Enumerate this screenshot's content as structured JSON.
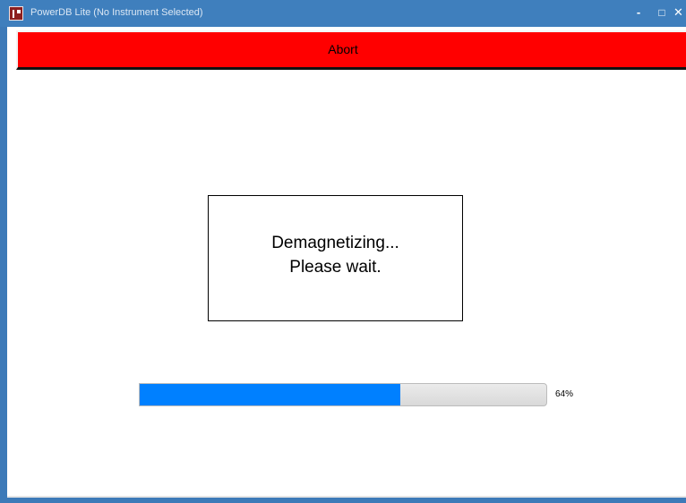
{
  "window": {
    "title": "PowerDB Lite (No Instrument Selected)",
    "minimize_glyph": "-",
    "maximize_glyph": "□",
    "close_glyph": "✕"
  },
  "toolbar": {
    "abort_label": "Abort",
    "abort_color": "#ff0000"
  },
  "status": {
    "line1": "Demagnetizing...",
    "line2": "Please wait."
  },
  "progress": {
    "value": 0.64,
    "label": "64%",
    "fill_color": "#0080ff"
  }
}
